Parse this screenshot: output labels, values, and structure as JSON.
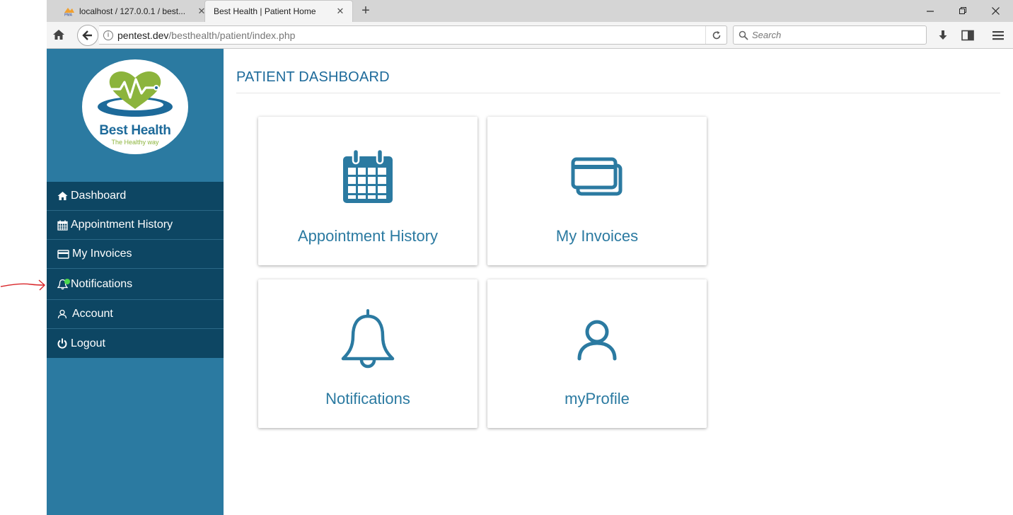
{
  "browser": {
    "tabs": [
      {
        "title": "localhost / 127.0.0.1 / best...",
        "favicon": "phpmyadmin-icon",
        "active": false
      },
      {
        "title": "Best Health | Patient Home",
        "active": true
      }
    ],
    "url": {
      "host": "pentest.dev",
      "path": "/besthealth/patient/index.php"
    },
    "search_placeholder": "Search"
  },
  "sidebar": {
    "logo": {
      "title": "Best Health",
      "tagline": "The Healthy way"
    },
    "menu": [
      {
        "label": "Dashboard",
        "icon": "home-icon"
      },
      {
        "label": "Appointment History",
        "icon": "calendar-icon"
      },
      {
        "label": "My Invoices",
        "icon": "credit-card-icon"
      },
      {
        "label": "Notifications",
        "icon": "bell-icon"
      },
      {
        "label": "Account",
        "icon": "user-icon"
      },
      {
        "label": "Logout",
        "icon": "power-icon"
      }
    ]
  },
  "main": {
    "title": "PATIENT DASHBOARD",
    "cards": [
      {
        "label": "Appointment History",
        "icon": "calendar-icon"
      },
      {
        "label": "My Invoices",
        "icon": "credit-card-icon"
      },
      {
        "label": "Notifications",
        "icon": "bell-icon"
      },
      {
        "label": "myProfile",
        "icon": "user-icon"
      }
    ]
  },
  "colors": {
    "sidebar_bg": "#2b7aa1",
    "menu_bg": "#0d4663",
    "accent": "#1d6a9a",
    "logo_green": "#8cb43c",
    "notification_dot": "#4cd94c",
    "annotation_red": "#d9262a"
  }
}
